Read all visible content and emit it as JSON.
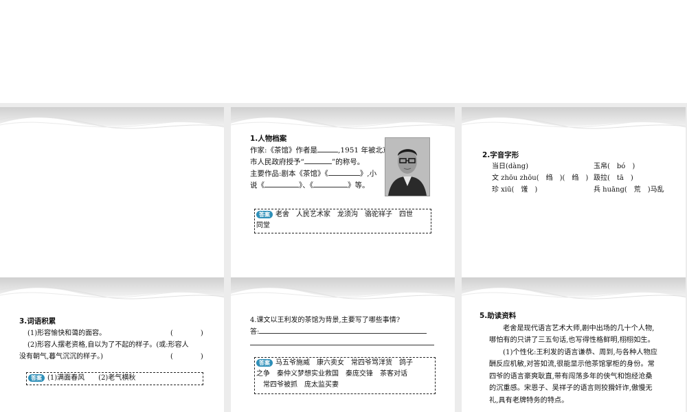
{
  "slides": {
    "s2": {
      "heading": "1.人物档案",
      "line1a": "作家:《茶馆》作者是",
      "line1b": ",1951 年被北京",
      "line2a": "市人民政府授予“",
      "line2b": "”的称号。",
      "line3a": "主要作品:剧本《茶馆》《",
      "line3b": "》,小",
      "line4a": "说《",
      "line4b": "》、《",
      "line4c": "》等。",
      "answer_tag": "答案",
      "answer_line1": "老舍　人民艺术家　龙须沟　骆驼祥子　四世",
      "answer_line2": "同堂",
      "photo_icon": "portrait-photo"
    },
    "s3": {
      "heading": "2.字音字形",
      "r1c1": "当日(dàng)",
      "r1c2": "玉帛(　bó　)",
      "r2c1": "文 zhōu zhōu(　绉　)(　绉　)",
      "r2c2": "趿拉(　tā　)",
      "r3c1": "珍 xiū(　馐　)",
      "r3c2": "兵 huāng(　荒　)马乱"
    },
    "s4": {
      "heading": "3.词语积累",
      "q1": "(1)形容愉快和蔼的面容。",
      "q1p": "(　　　　)",
      "q2a": "(2)形容人摆老资格,自以为了不起的样子。(或:形容人",
      "q2b": "没有朝气,暮气沉沉的样子。)",
      "q2p": "(　　　　)",
      "answer_tag": "答案",
      "answer": "(1)满面春风　　(2)老气横秋"
    },
    "s5": {
      "question": "4.课文以王利发的茶馆为背景,主要写了哪些事情?",
      "answer_prefix": "答:",
      "answer_tag": "答案",
      "answer_line1": "马五爷施威　康六卖女　常四爷骂洋货　鸽子",
      "answer_line2": "之争　秦仲义梦想实业救国　秦庞交锋　茶客对话",
      "answer_line3": "常四爷被抓　庞太监买妻"
    },
    "s6": {
      "heading": "5.助读资料",
      "p1a": "老舍是现代语言艺术大师,剧中出场的几十个人物,",
      "p1b": "哪怕有的只讲了三五句话,也写得性格鲜明,栩栩如生。",
      "p2a": "(1)个性化:王利发的语言谦恭、周到,与各种人物应",
      "p2b": "酬反应机敏,对答如流,很能显示他茶馆掌柜的身份。常",
      "p2c": "四爷的语言豪爽耿直,带有闯荡多年的侠气和饱经沧桑",
      "p2d": "的沉重感。宋恩子、吴祥子的语言则狡猾奸诈,傲慢无",
      "p2e": "礼,具有老牌特务的特点。"
    }
  },
  "colors": {
    "tag": "#2e8fb8",
    "wave": "#d6d6d6",
    "background": "#ececec"
  }
}
